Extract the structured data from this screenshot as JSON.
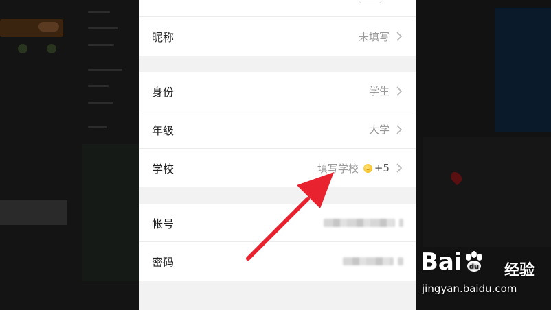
{
  "profile": {
    "nickname": {
      "label": "昵称",
      "value": "未填写"
    },
    "identity": {
      "label": "身份",
      "value": "学生"
    },
    "grade": {
      "label": "年级",
      "value": "大学"
    },
    "school": {
      "label": "学校",
      "value": "填写学校",
      "reward": "+5"
    },
    "account": {
      "label": "帐号"
    },
    "password": {
      "label": "密码"
    }
  },
  "annotation": {
    "arrow_color": "#e8232f",
    "points_to": "school"
  },
  "watermark": {
    "brand": "Bai du",
    "cn": "经验",
    "url": "jingyan.baidu.com"
  },
  "colors": {
    "panel_bg": "#f2f2f2",
    "row_bg": "#ffffff",
    "value_text": "#9a9a9a",
    "label_text": "#222222"
  }
}
